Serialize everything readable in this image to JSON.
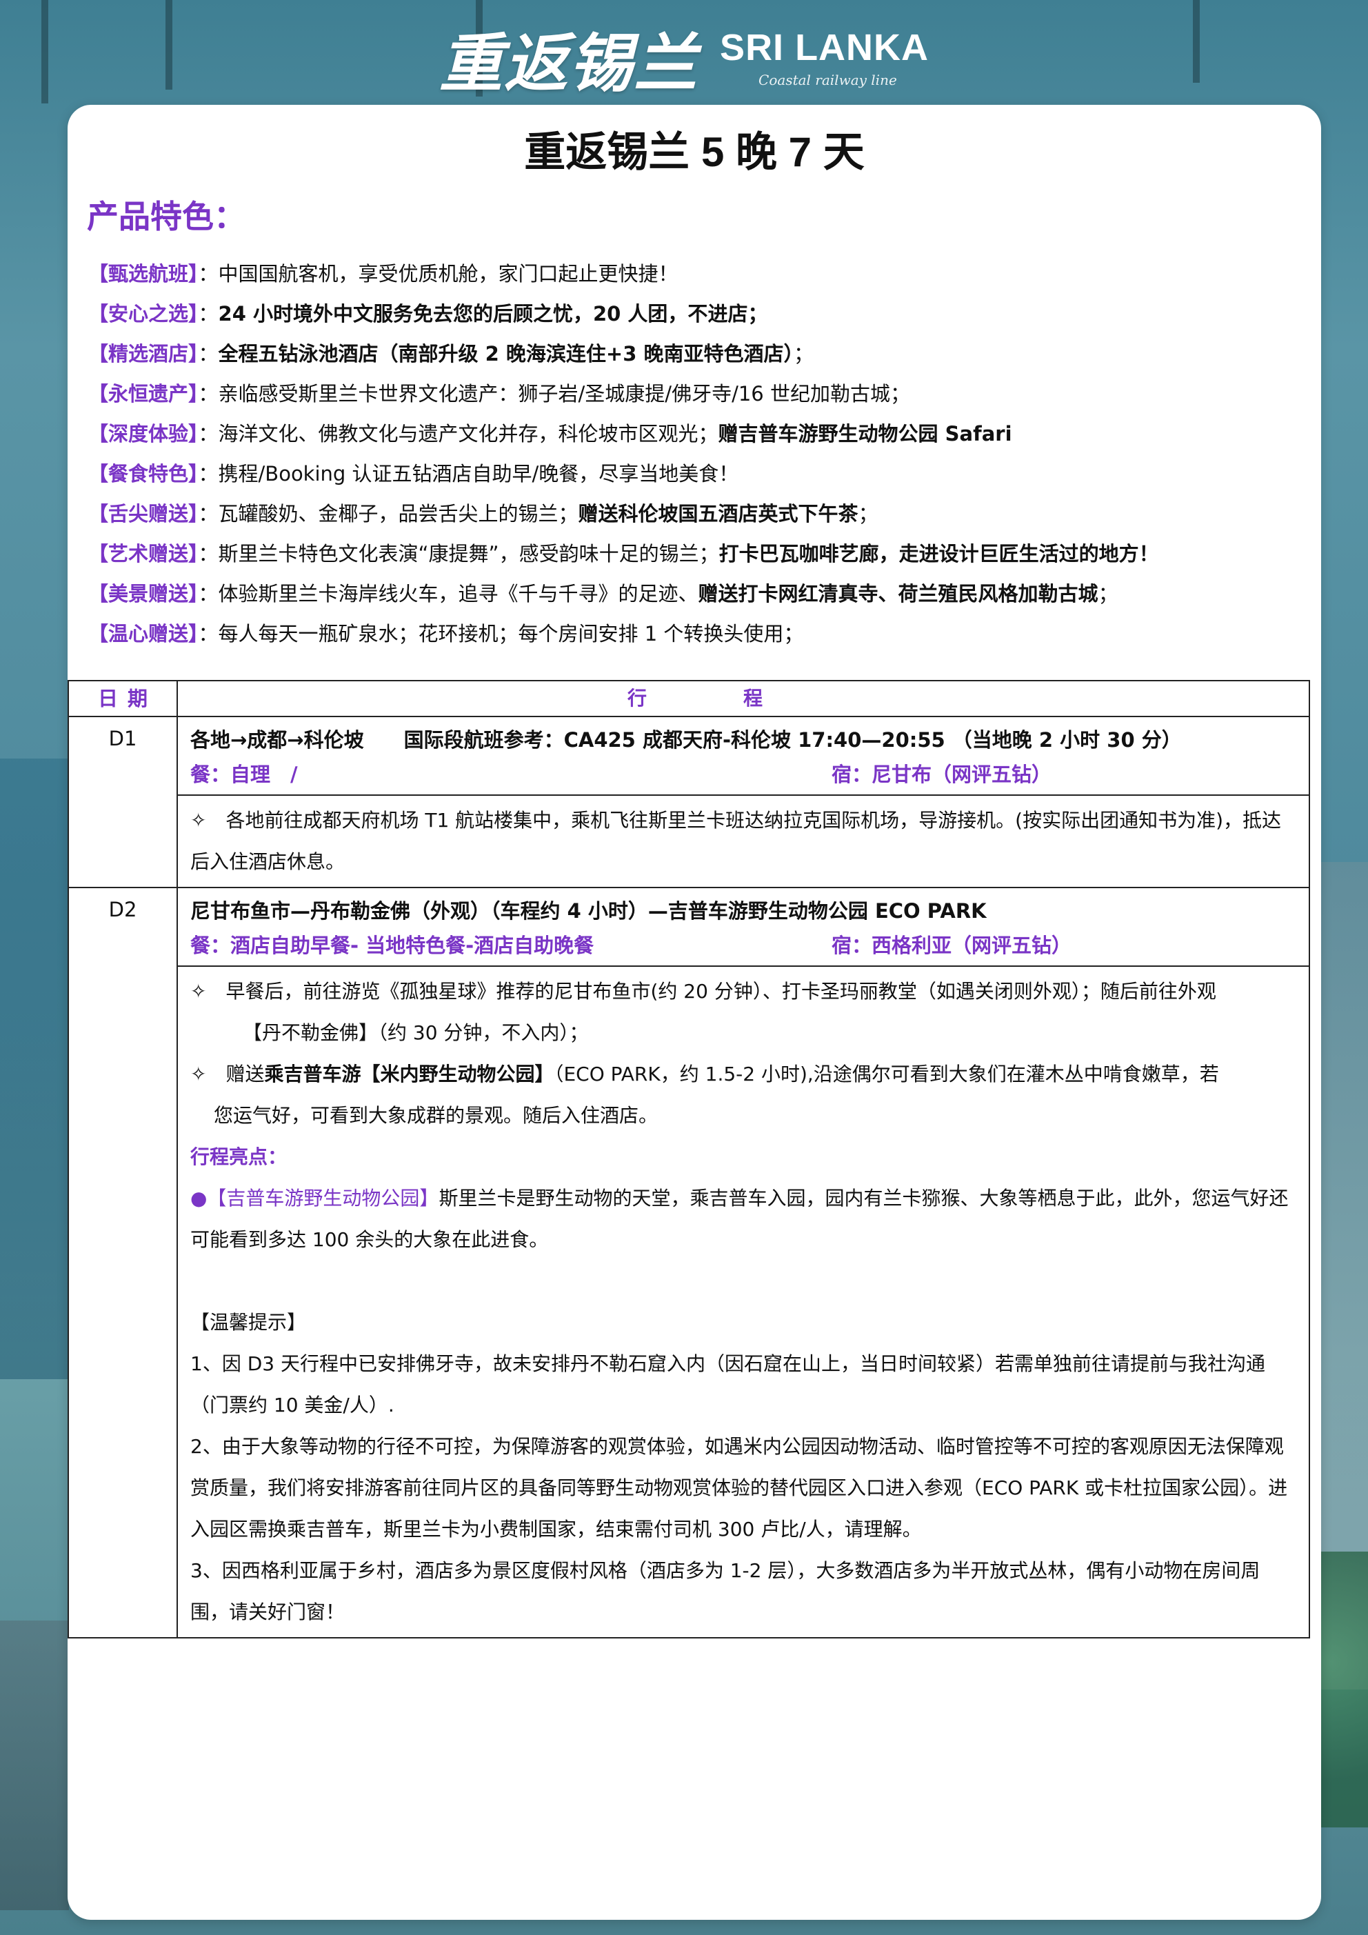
{
  "header": {
    "logo_cn": "重返锡兰",
    "logo_en": "SRI LANKA",
    "logo_sub": "Coastal railway line"
  },
  "title": "重返锡兰 5 晚 7 天",
  "features_heading": "产品特色：",
  "features": [
    {
      "tag": "【甄选航班】",
      "parts": [
        {
          "t": "中国国航客机，享受优质机舱，家门口起止更快捷！",
          "b": false
        }
      ]
    },
    {
      "tag": "【安心之选】",
      "parts": [
        {
          "t": "24 小时境外中文服务免去您的后顾之忧，20 人团，不进店；",
          "b": true
        }
      ]
    },
    {
      "tag": "【精选酒店】",
      "parts": [
        {
          "t": "全程五钻泳池酒店（南部升级 2 晚海滨连住+3 晚南亚特色酒店）",
          "b": true
        },
        {
          "t": "；",
          "b": false
        }
      ]
    },
    {
      "tag": "【永恒遗产】",
      "parts": [
        {
          "t": "亲临感受斯里兰卡世界文化遗产：狮子岩/圣城康提/佛牙寺/16 世纪加勒古城；",
          "b": false
        }
      ]
    },
    {
      "tag": "【深度体验】",
      "parts": [
        {
          "t": "海洋文化、佛教文化与遗产文化并存，科伦坡市区观光；",
          "b": false
        },
        {
          "t": "赠吉普车游野生动物公园 Safari",
          "b": true
        }
      ]
    },
    {
      "tag": "【餐食特色】",
      "parts": [
        {
          "t": "携程/Booking 认证五钻酒店自助早/晚餐，尽享当地美食！",
          "b": false
        }
      ]
    },
    {
      "tag": "【舌尖赠送】",
      "parts": [
        {
          "t": "瓦罐酸奶、金椰子，品尝舌尖上的锡兰；",
          "b": false
        },
        {
          "t": "赠送科伦坡国五酒店英式下午茶",
          "b": true
        },
        {
          "t": "；",
          "b": false
        }
      ]
    },
    {
      "tag": "【艺术赠送】",
      "parts": [
        {
          "t": "斯里兰卡特色文化表演“康提舞”，感受韵味十足的锡兰；",
          "b": false
        },
        {
          "t": "打卡巴瓦咖啡艺廊，走进设计巨匠生活过的地方！",
          "b": true
        }
      ]
    },
    {
      "tag": "【美景赠送】",
      "parts": [
        {
          "t": "体验斯里兰卡海岸线火车，追寻《千与千寻》的足迹、",
          "b": false
        },
        {
          "t": "赠送打卡网红清真寺、荷兰殖民风格加勒古城",
          "b": true
        },
        {
          "t": "；",
          "b": false
        }
      ]
    },
    {
      "tag": "【温心赠送】",
      "parts": [
        {
          "t": "每人每天一瓶矿泉水；花环接机；每个房间安排 1 个转换头使用；",
          "b": false
        }
      ]
    }
  ],
  "table": {
    "col_day": "日期",
    "col_itinerary": "行程",
    "d1": {
      "day": "D1",
      "title": "各地→成都→科伦坡　　国际段航班参考：CA425 成都天府-科伦坡 17:40—20:55 （当地晚 2 小时 30 分）",
      "meal": "餐：自理　/",
      "stay": "宿：尼甘布（网评五钻）",
      "body": "✧　各地前往成都天府机场 T1 航站楼集中，乘机飞往斯里兰卡班达纳拉克国际机场，导游接机。(按实际出团通知书为准)，抵达后入住酒店休息。"
    },
    "d2": {
      "day": "D2",
      "title": "尼甘布鱼市—丹布勒金佛（外观）（车程约 4 小时）—吉普车游野生动物公园 ECO PARK",
      "meal": "餐：酒店自助早餐- 当地特色餐-酒店自助晚餐",
      "stay": "宿：西格利亚（网评五钻）",
      "p1a": "✧　早餐后，前往游览《孤独星球》推荐的尼甘布鱼市(约 20 分钟）、打卡圣玛丽教堂（如遇关闭则外观）；随后前往外观",
      "p1b": "【丹不勒金佛】（约 30 分钟，不入内）；",
      "p2_pre": "✧　赠送",
      "p2_bold": "乘吉普车游【米内野生动物公园】",
      "p2_post": "（ECO PARK，约 1.5-2 小时),沿途偶尔可看到大象们在灌木丛中啃食嫩草，若",
      "p2b": "您运气好，可看到大象成群的景观。随后入住酒店。",
      "highlight_title": "行程亮点：",
      "highlight_tag": "●【吉普车游野生动物公园】",
      "highlight_text": "斯里兰卡是野生动物的天堂，乘吉普车入园，园内有兰卡猕猴、大象等栖息于此，此外，您运气好还可能看到多达 100 余头的大象在此进食。",
      "tips_title": "【温馨提示】",
      "tips": [
        "1、因 D3 天行程中已安排佛牙寺，故未安排丹不勒石窟入内（因石窟在山上，当日时间较紧）若需单独前往请提前与我社沟通（门票约 10 美金/人）.",
        "2、由于大象等动物的行径不可控，为保障游客的观赏体验，如遇米内公园因动物活动、临时管控等不可控的客观原因无法保障观赏质量，我们将安排游客前往同片区的具备同等野生动物观赏体验的替代园区入口进入参观（ECO PARK 或卡杜拉国家公园）。进入园区需换乘吉普车，斯里兰卡为小费制国家，结束需付司机 300 卢比/人，请理解。",
        "3、因西格利亚属于乡村，酒店多为景区度假村风格（酒店多为 1-2 层），大多数酒店多为半开放式丛林，偶有小动物在房间周围，请关好门窗！"
      ]
    }
  }
}
